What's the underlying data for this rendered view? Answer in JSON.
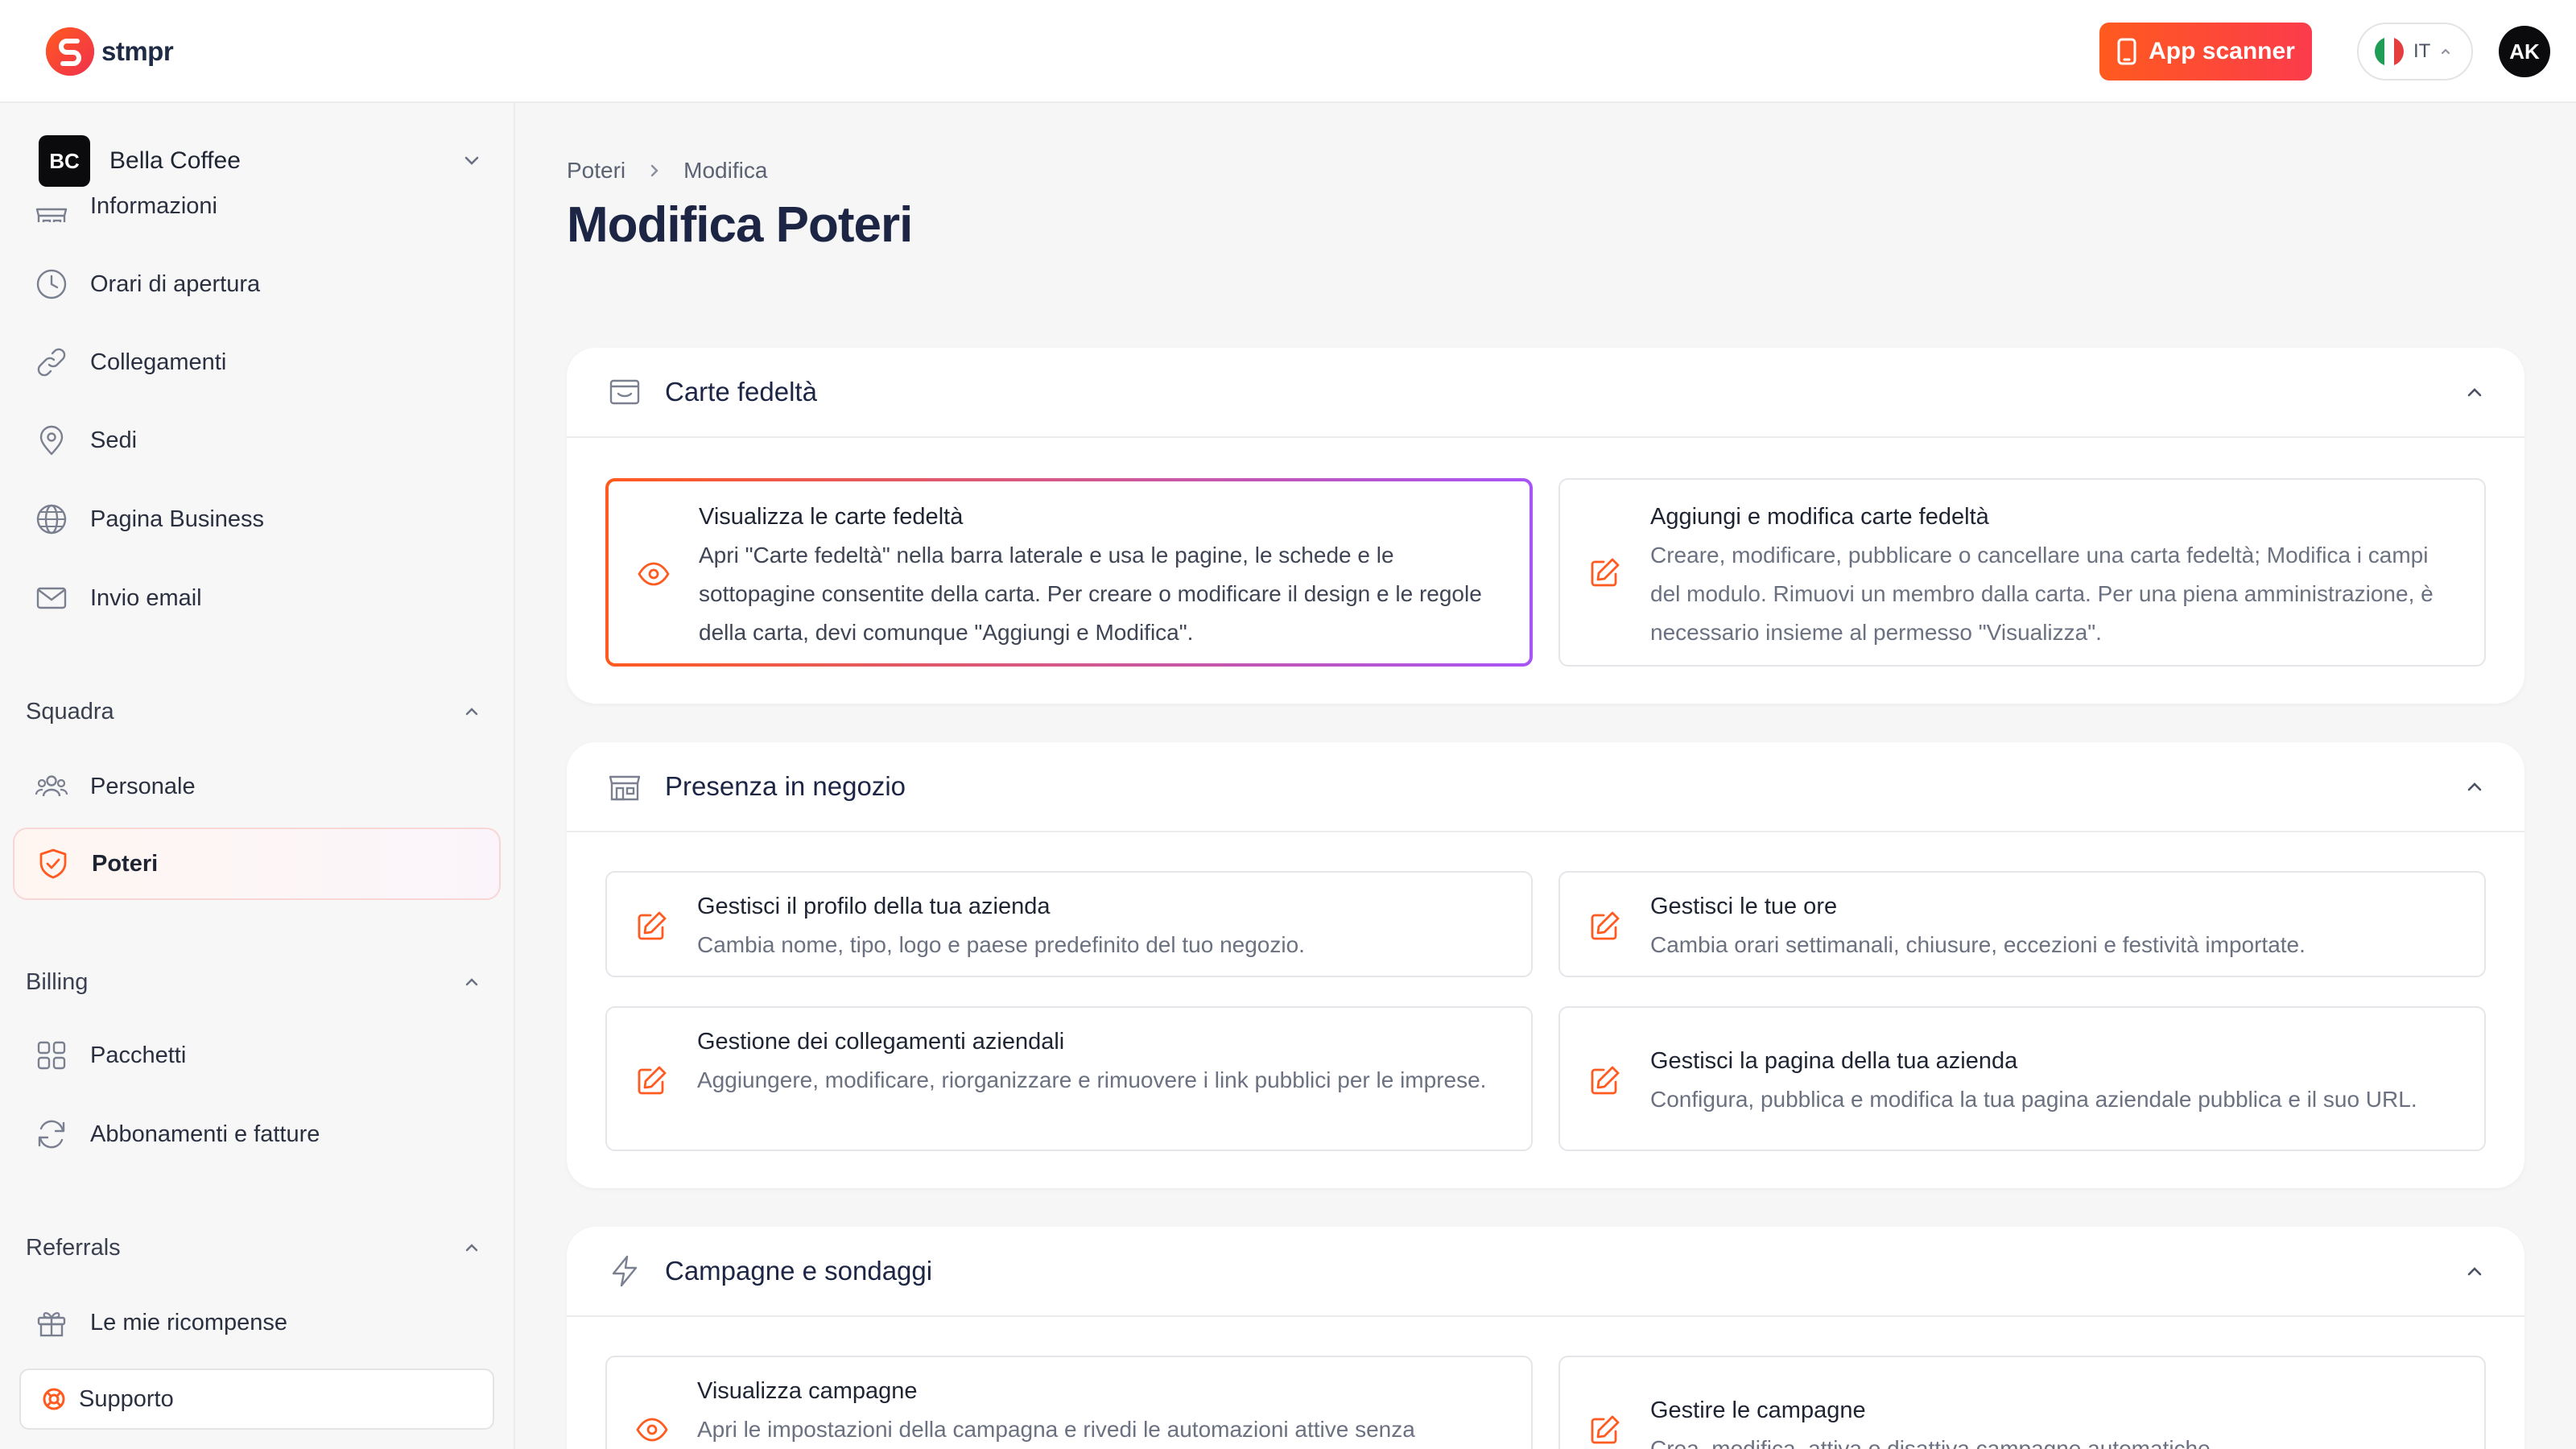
{
  "brand": {
    "name": "stmpr",
    "accent": "#ff5a1f",
    "accent2": "#fb3b4b"
  },
  "topbar": {
    "scanner_label": "App scanner",
    "scanner_icon": "phone-icon",
    "language": "IT",
    "avatar_initials": "AK"
  },
  "sidebar": {
    "workspace": {
      "initials": "BC",
      "name": "Bella Coffee"
    },
    "items": [
      {
        "label": "Informazioni",
        "icon": "store-icon"
      },
      {
        "label": "Orari di apertura",
        "icon": "clock-icon"
      },
      {
        "label": "Collegamenti",
        "icon": "link-icon"
      },
      {
        "label": "Sedi",
        "icon": "map-pin-icon"
      },
      {
        "label": "Pagina Business",
        "icon": "globe-icon"
      },
      {
        "label": "Invio email",
        "icon": "mail-icon"
      }
    ],
    "sections": {
      "team": {
        "title": "Squadra",
        "items": [
          {
            "label": "Personale",
            "icon": "users-icon"
          },
          {
            "label": "Poteri",
            "icon": "shield-check-icon",
            "active": true
          }
        ]
      },
      "billing": {
        "title": "Billing",
        "items": [
          {
            "label": "Pacchetti",
            "icon": "grid-icon"
          },
          {
            "label": "Abbonamenti e fatture",
            "icon": "refresh-icon"
          }
        ]
      },
      "referrals": {
        "title": "Referrals",
        "items": [
          {
            "label": "Le mie ricompense",
            "icon": "gift-icon"
          }
        ]
      }
    },
    "support_label": "Supporto"
  },
  "breadcrumb": {
    "parent": "Poteri",
    "current": "Modifica"
  },
  "page_title": "Modifica Poteri",
  "groups": [
    {
      "title": "Carte fedeltà",
      "icon": "wallet-icon",
      "permissions": [
        {
          "title": "Visualizza le carte fedeltà",
          "description": "Apri \"Carte fedeltà\" nella barra laterale e usa le pagine, le schede e le sottopagine consentite della carta. Per creare o modificare il design e le regole della carta, devi comunque \"Aggiungi e Modifica\".",
          "icon": "eye-icon",
          "selected": true
        },
        {
          "title": "Aggiungi e modifica carte fedeltà",
          "description": "Creare, modificare, pubblicare o cancellare una carta fedeltà; Modifica i campi del modulo. Rimuovi un membro dalla carta. Per una piena amministrazione, è necessario insieme al permesso \"Visualizza\".",
          "icon": "edit-icon",
          "selected": false
        }
      ]
    },
    {
      "title": "Presenza in negozio",
      "icon": "store-icon",
      "permissions": [
        {
          "title": "Gestisci il profilo della tua azienda",
          "description": "Cambia nome, tipo, logo e paese predefinito del tuo negozio.",
          "icon": "edit-icon"
        },
        {
          "title": "Gestisci le tue ore",
          "description": "Cambia orari settimanali, chiusure, eccezioni e festività importate.",
          "icon": "edit-icon"
        },
        {
          "title": "Gestione dei collegamenti aziendali",
          "description": "Aggiungere, modificare, riorganizzare e rimuovere i link pubblici per le imprese.",
          "icon": "edit-icon"
        },
        {
          "title": "Gestisci la pagina della tua azienda",
          "description": "Configura, pubblica e modifica la tua pagina aziendale pubblica e il suo URL.",
          "icon": "edit-icon"
        }
      ]
    },
    {
      "title": "Campagne e sondaggi",
      "icon": "bolt-icon",
      "permissions": [
        {
          "title": "Visualizza campagne",
          "description": "Apri le impostazioni della campagna e rivedi le automazioni attive senza",
          "icon": "eye-icon"
        },
        {
          "title": "Gestire le campagne",
          "description": "Crea, modifica, attiva o disattiva campagne automatiche.",
          "icon": "edit-icon"
        }
      ]
    }
  ]
}
